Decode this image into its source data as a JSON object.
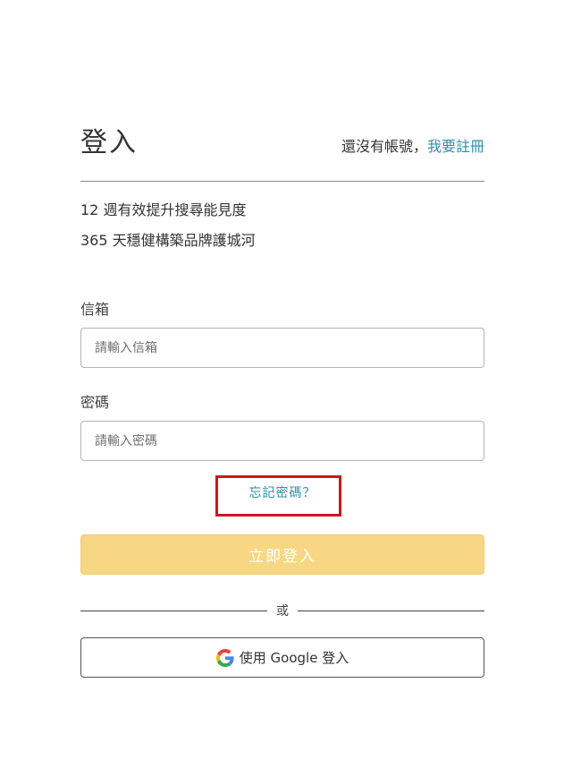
{
  "header": {
    "title": "登入",
    "signup_prompt": "還沒有帳號，",
    "signup_link": "我要註冊"
  },
  "benefits": [
    "12 週有效提升搜尋能見度",
    "365 天穩健構築品牌護城河"
  ],
  "form": {
    "email_label": "信箱",
    "email_placeholder": "請輸入信箱",
    "email_value": "",
    "password_label": "密碼",
    "password_placeholder": "請輸入密碼",
    "password_value": "",
    "forgot_password": "忘記密碼？",
    "submit_label": "立即登入"
  },
  "divider": {
    "or_label": "或"
  },
  "google": {
    "label": "使用 Google 登入",
    "icon": "google-icon"
  },
  "colors": {
    "accent_link": "#2e8fad",
    "login_button_bg": "#f8d784",
    "highlight_box": "#c8191e"
  }
}
